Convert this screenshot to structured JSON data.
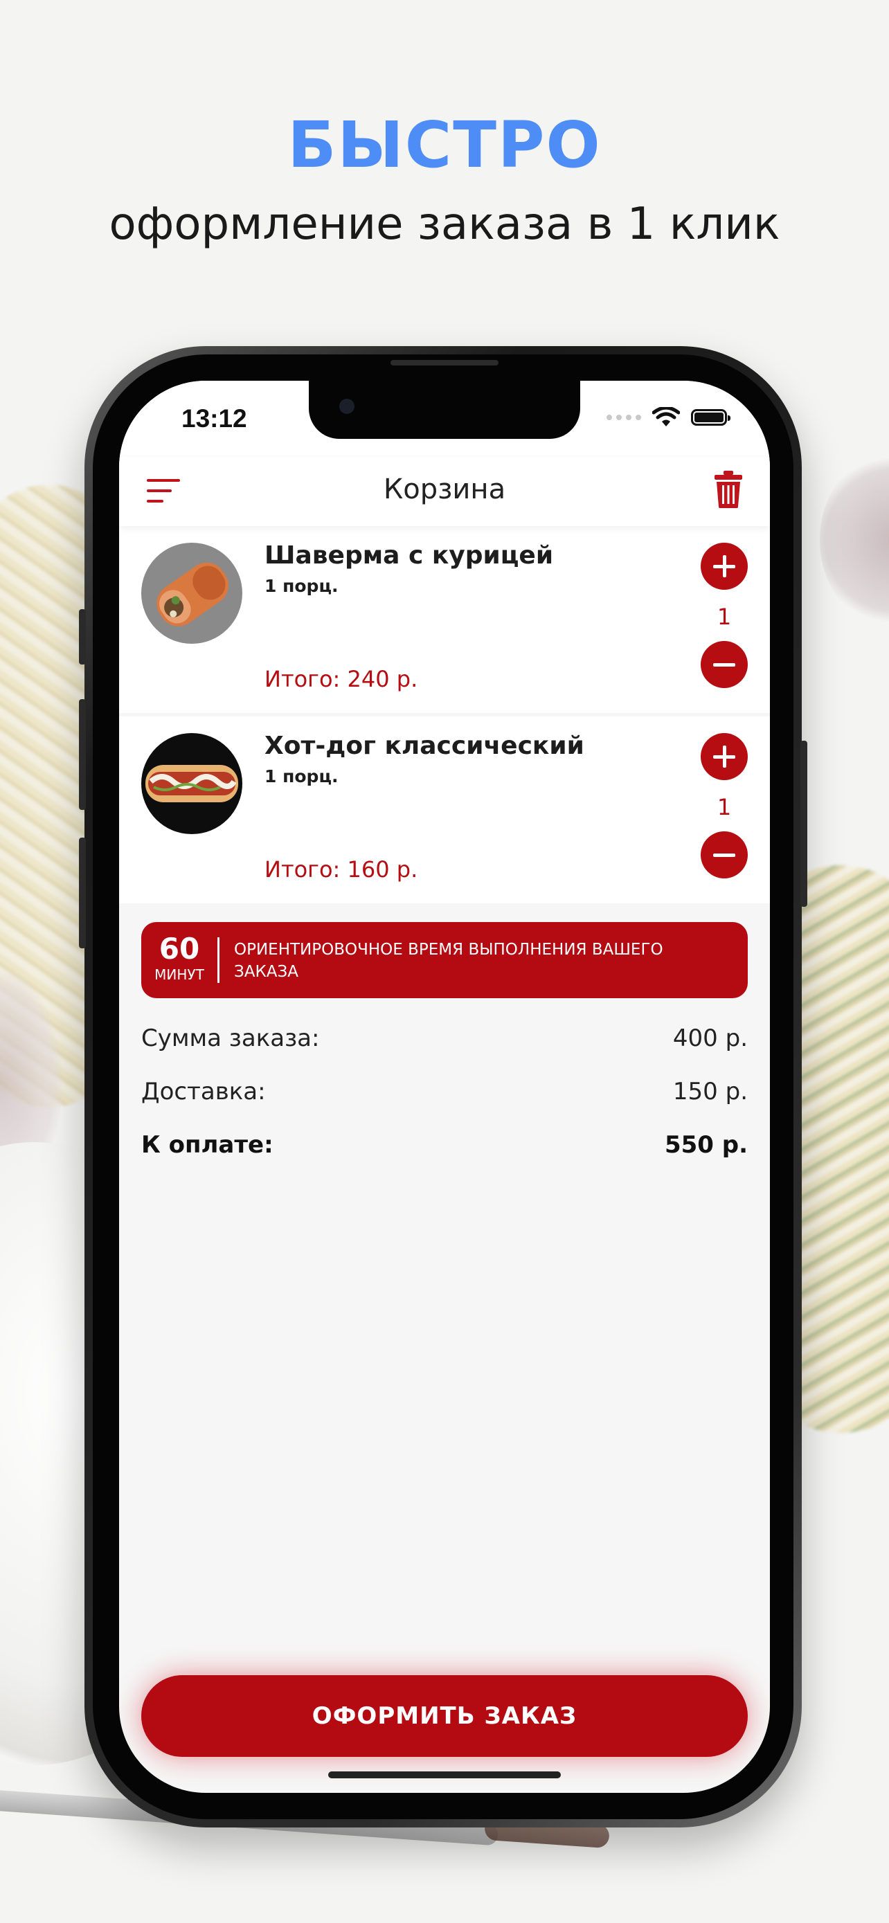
{
  "headline": {
    "title": "БЫСТРО",
    "subtitle": "оформление заказа в 1 клик"
  },
  "status_bar": {
    "time": "13:12"
  },
  "header": {
    "title": "Корзина"
  },
  "cart": {
    "items": [
      {
        "name": "Шаверма с курицей",
        "portion": "1 порц.",
        "total": "Итого: 240 р.",
        "quantity": "1",
        "image": "shawarma-image"
      },
      {
        "name": "Хот-дог классический",
        "portion": "1 порц.",
        "total": "Итого: 160 р.",
        "quantity": "1",
        "image": "hotdog-image"
      }
    ]
  },
  "time_banner": {
    "value": "60",
    "unit": "МИНУТ",
    "text": "ОРИЕНТИРОВОЧНОЕ ВРЕМЯ ВЫПОЛНЕНИЯ ВАШЕГО ЗАКАЗА"
  },
  "summary": {
    "subtotal_label": "Сумма заказа:",
    "subtotal_value": "400 р.",
    "delivery_label": "Доставка:",
    "delivery_value": "150 р.",
    "total_label": "К оплате:",
    "total_value": "550 р."
  },
  "checkout": {
    "label": "ОФОРМИТЬ ЗАКАЗ"
  },
  "colors": {
    "accent": "#b40a12",
    "headline_blue": "#4d8df5",
    "screen_bg": "#f6f6f6"
  }
}
